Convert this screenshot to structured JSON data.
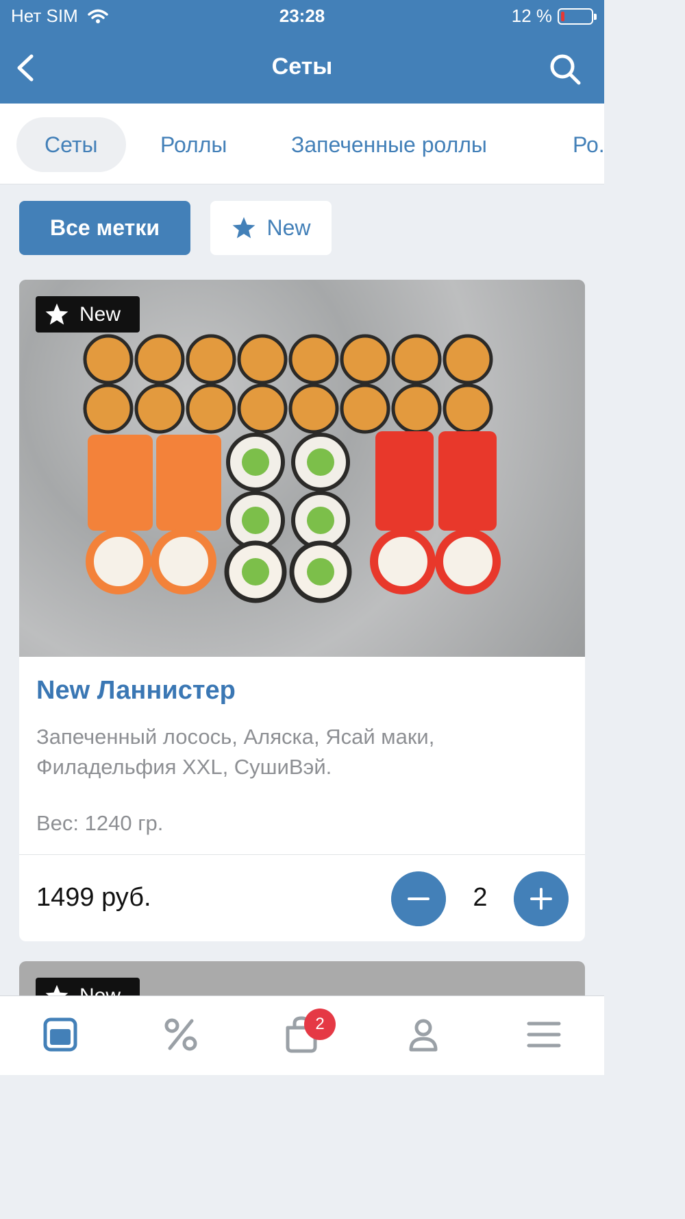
{
  "status": {
    "carrier": "Нет SIM",
    "time": "23:28",
    "battery": "12 %"
  },
  "nav": {
    "title": "Сеты"
  },
  "categories": [
    "Сеты",
    "Роллы",
    "Запеченные роллы",
    "Ро..."
  ],
  "filters": {
    "all": "Все метки",
    "new": "New"
  },
  "product": {
    "badge": "New",
    "title": "New Ланнистер",
    "description": "Запеченный лосось, Аляска, Ясай маки, Филадельфия XXL, СушиВэй.",
    "weight": "Вес: 1240 гр.",
    "price": "1499 руб.",
    "quantity": "2"
  },
  "next_product": {
    "badge": "New"
  },
  "tabbar": {
    "cart_count": "2"
  },
  "colors": {
    "primary": "#4380b8",
    "badge": "#e53945"
  }
}
